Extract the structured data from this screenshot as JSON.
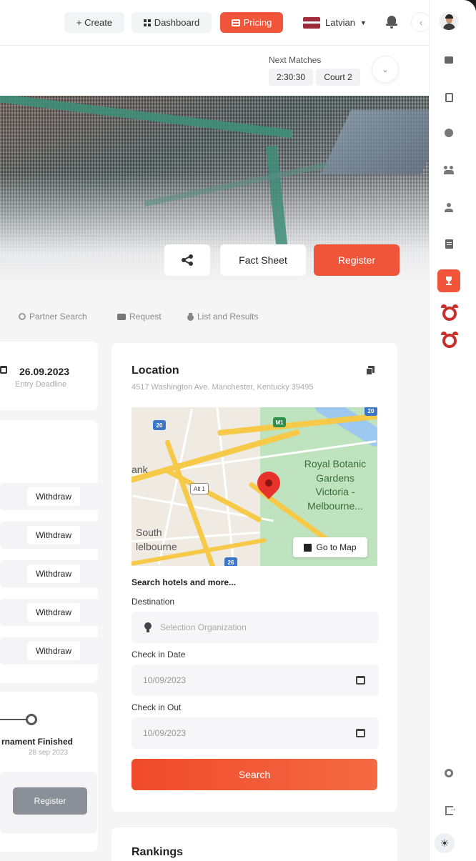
{
  "topbar": {
    "create_label": "+ Create",
    "dashboard_label": "Dashboard",
    "pricing_label": "Pricing",
    "language_label": "Latvian",
    "collapse_glyph": "‹"
  },
  "next_matches": {
    "label": "Next Matches",
    "time": "2:30:30",
    "court": "Court 2"
  },
  "hero_actions": {
    "fact_sheet_label": "Fact Sheet",
    "register_label": "Register"
  },
  "tabs": [
    {
      "label": "Partner Search",
      "icon": "search-icon"
    },
    {
      "label": "Request",
      "icon": "chat-icon"
    },
    {
      "label": "List and Results",
      "icon": "medal-icon"
    }
  ],
  "deadline": {
    "date": "26.09.2023",
    "label": "Entry Deadline"
  },
  "players": {
    "withdraw_label": "Withdraw"
  },
  "status": {
    "title": "rnament Finished",
    "date": "28 sep 2023",
    "register_label": "Register"
  },
  "location": {
    "title": "Location",
    "address": "4517 Washington Ave. Manchester, Kentucky 39495",
    "map": {
      "park_label_lines": [
        "Royal Botanic",
        "Gardens",
        "Victoria -",
        "Melbourne..."
      ],
      "area_label": "ank",
      "suburb_lines": [
        "South",
        "lelbourne"
      ],
      "route_alt": "Alt 1",
      "route_a": "20",
      "route_b": "M1",
      "route_c": "20",
      "route_d": "26",
      "go_to_map_label": "Go to Map"
    },
    "hotels_title": "Search hotels and more...",
    "destination_label": "Destination",
    "destination_placeholder": "Selection Organization",
    "check_in_label": "Check in Date",
    "check_in_value": "10/09/2023",
    "check_out_label": "Check in Out",
    "check_out_value": "10/09/2023",
    "search_label": "Search"
  },
  "rankings": {
    "title": "Rankings"
  },
  "theme": {
    "glyph": "☀"
  },
  "colors": {
    "accent": "#f0553a",
    "alarm": "#c9302c",
    "park": "#bfe3bf",
    "road": "#f6c948"
  }
}
